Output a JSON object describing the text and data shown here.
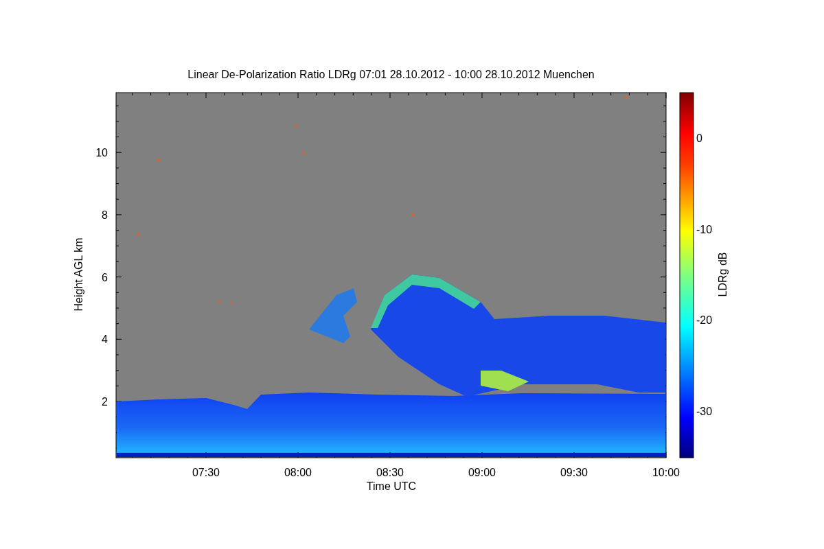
{
  "plot": {
    "title": "Linear De-Polarization Ratio LDRg   07:01 28.10.2012 - 10:00 28.10.2012 Muenchen",
    "xlabel": "Time UTC",
    "ylabel": "Height AGL km",
    "xtick_labels": [
      "07:30",
      "08:00",
      "08:30",
      "09:00",
      "09:30",
      "10:00"
    ],
    "ytick_labels": [
      "10",
      "8",
      "6",
      "4",
      "2"
    ]
  },
  "colorbar": {
    "label": "LDRg dB",
    "tick_labels": [
      "0",
      "-10",
      "-20",
      "-30"
    ]
  }
}
